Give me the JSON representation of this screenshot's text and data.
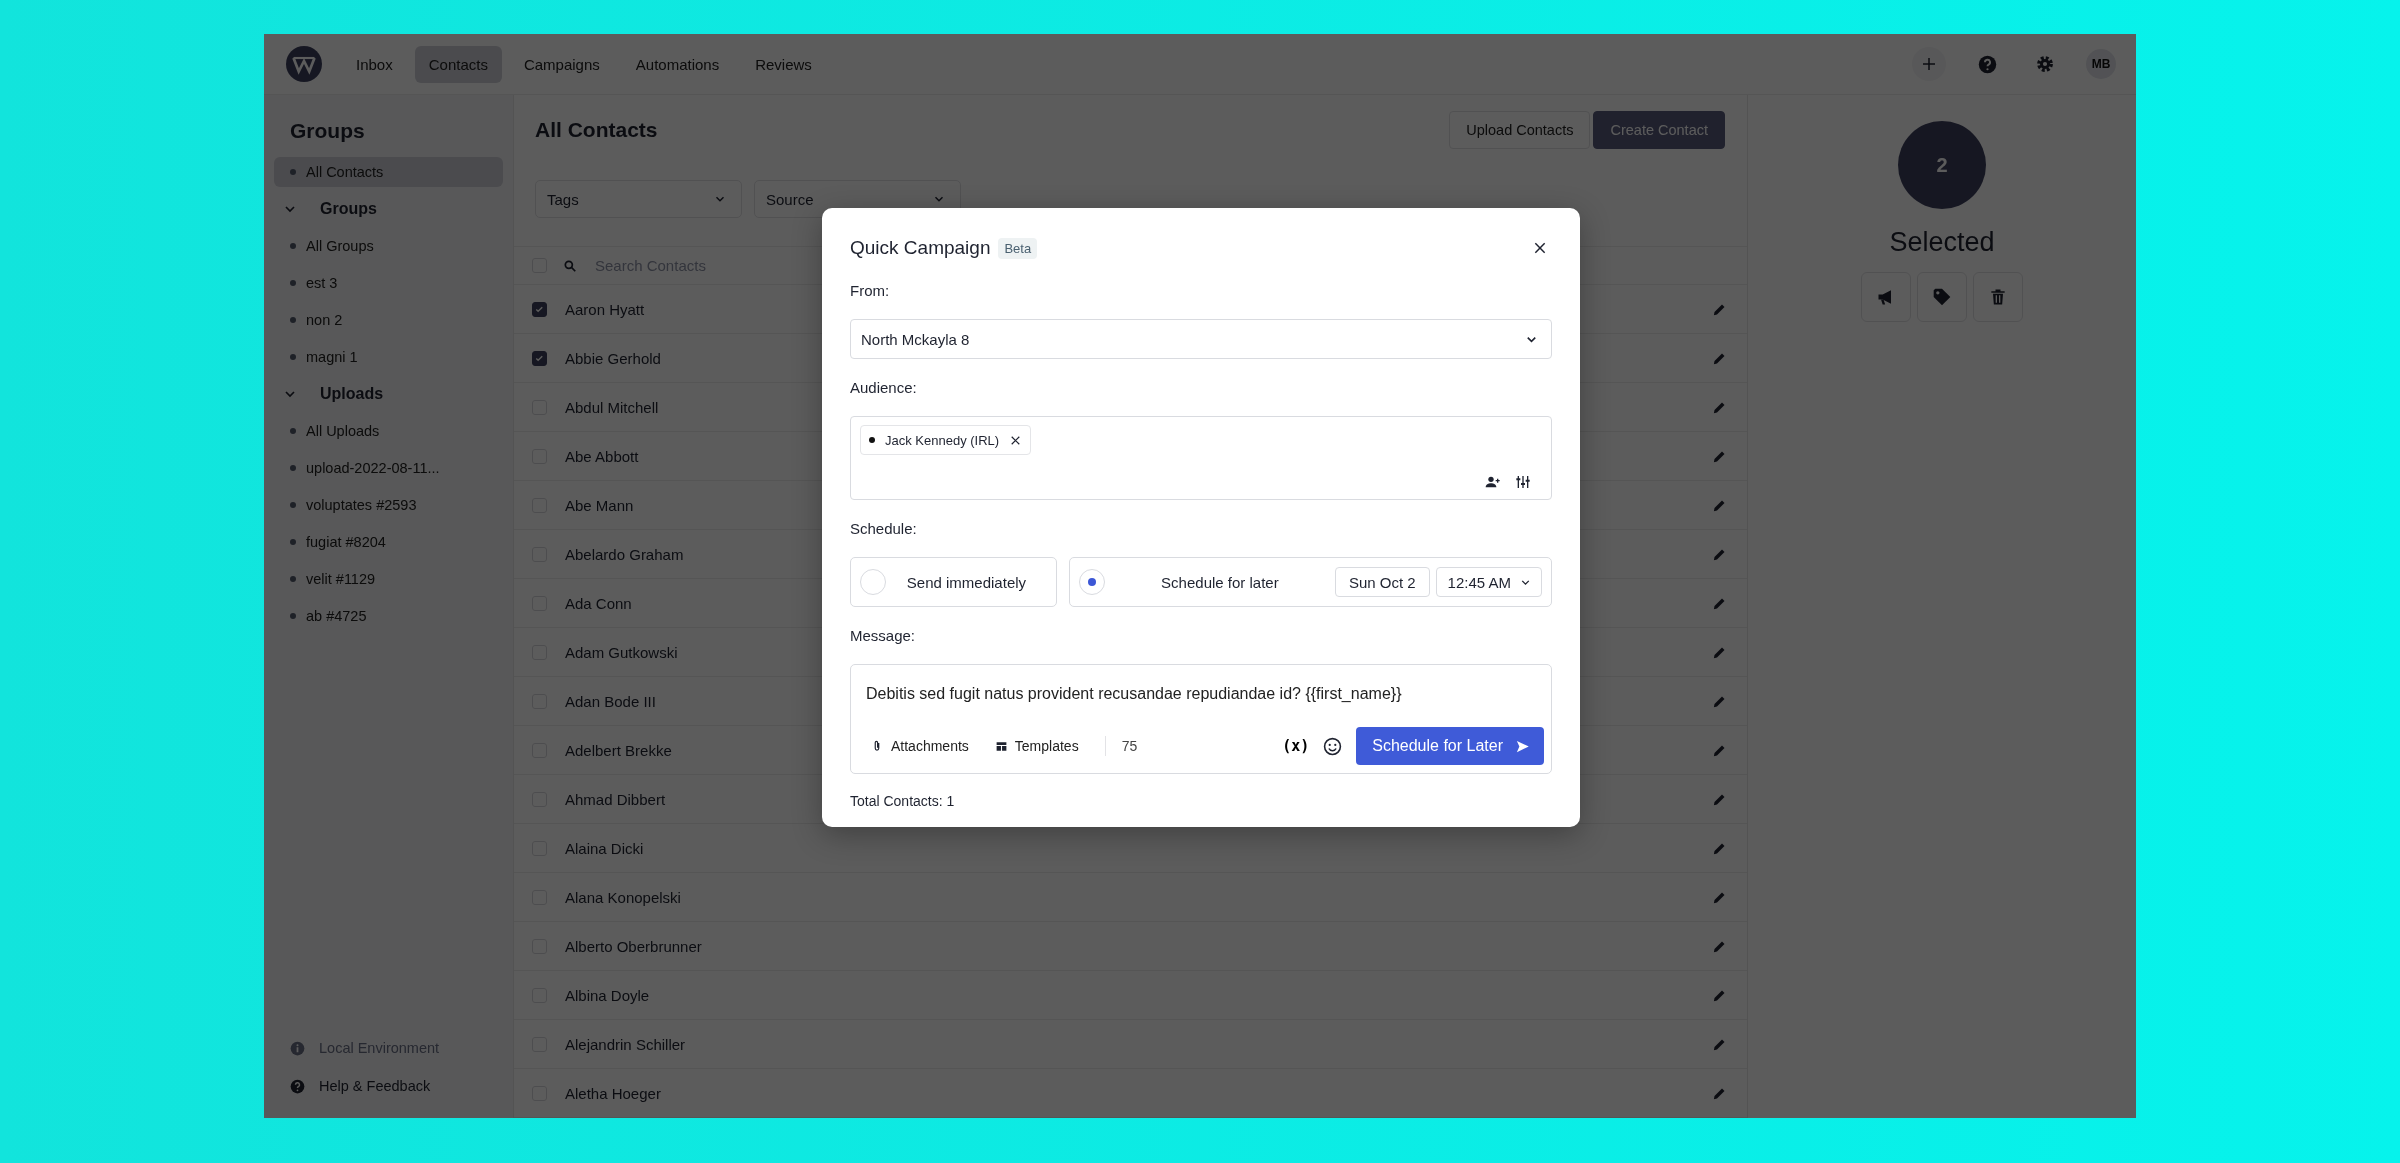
{
  "header": {
    "tabs": [
      {
        "label": "Inbox",
        "selected": false
      },
      {
        "label": "Contacts",
        "selected": true
      },
      {
        "label": "Campaigns",
        "selected": false
      },
      {
        "label": "Automations",
        "selected": false
      },
      {
        "label": "Reviews",
        "selected": false
      }
    ],
    "avatar": "MB"
  },
  "sidebar": {
    "title": "Groups",
    "items": [
      {
        "label": "All Contacts",
        "selected": true
      }
    ],
    "sections": [
      {
        "label": "Groups",
        "expanded": true,
        "children": [
          {
            "label": "All Groups",
            "selected": false
          },
          {
            "label": "est 3",
            "selected": false
          },
          {
            "label": "non 2",
            "selected": false
          },
          {
            "label": "magni 1",
            "selected": false
          }
        ]
      },
      {
        "label": "Uploads",
        "expanded": true,
        "children": [
          {
            "label": "All Uploads",
            "selected": false
          },
          {
            "label": "upload-2022-08-11...",
            "selected": false
          },
          {
            "label": "voluptates #2593",
            "selected": false
          },
          {
            "label": "fugiat #8204",
            "selected": false
          },
          {
            "label": "velit #1129",
            "selected": false
          },
          {
            "label": "ab #4725",
            "selected": false
          }
        ]
      }
    ],
    "footer": [
      {
        "kind": "info",
        "label": "Local Environment"
      },
      {
        "kind": "help",
        "label": "Help & Feedback"
      }
    ]
  },
  "main": {
    "title": "All Contacts",
    "buttons": [
      {
        "label": "Upload Contacts",
        "kind": "secondary"
      },
      {
        "label": "Create Contact",
        "kind": "primary"
      }
    ],
    "filters": [
      "Tags",
      "Source"
    ],
    "search": {
      "placeholder": "Search Contacts",
      "checked": false
    },
    "contacts": [
      {
        "name": "Aaron Hyatt",
        "checked": true
      },
      {
        "name": "Abbie Gerhold",
        "checked": true
      },
      {
        "name": "Abdul Mitchell",
        "checked": false
      },
      {
        "name": "Abe Abbott",
        "checked": false
      },
      {
        "name": "Abe Mann",
        "checked": false
      },
      {
        "name": "Abelardo Graham",
        "checked": false
      },
      {
        "name": "Ada Conn",
        "checked": false
      },
      {
        "name": "Adam Gutkowski",
        "checked": false
      },
      {
        "name": "Adan Bode III",
        "checked": false
      },
      {
        "name": "Adelbert Brekke",
        "checked": false
      },
      {
        "name": "Ahmad Dibbert",
        "checked": false
      },
      {
        "name": "Alaina Dicki",
        "checked": false
      },
      {
        "name": "Alana Konopelski",
        "checked": false
      },
      {
        "name": "Alberto Oberbrunner",
        "checked": false
      },
      {
        "name": "Albina Doyle",
        "checked": false
      },
      {
        "name": "Alejandrin Schiller",
        "checked": false
      },
      {
        "name": "Aletha Hoeger",
        "checked": false
      }
    ]
  },
  "selection_panel": {
    "count": "2",
    "label": "Selected"
  },
  "modal": {
    "title": "Quick Campaign",
    "badge": "Beta",
    "from": {
      "label": "From:",
      "value": "North Mckayla 8"
    },
    "audience": {
      "label": "Audience:",
      "chips": [
        "Jack Kennedy (IRL)"
      ]
    },
    "schedule": {
      "label": "Schedule:",
      "options": [
        {
          "label": "Send immediately",
          "selected": false
        },
        {
          "label": "Schedule for later",
          "selected": true
        }
      ],
      "date": "Sun Oct 2",
      "time": "12:45 AM"
    },
    "message": {
      "label": "Message:",
      "value": "Debitis sed fugit natus provident recusandae repudiandae id? {{first_name}}",
      "attachments": "Attachments",
      "templates": "Templates",
      "count": "75",
      "variable": "(x)",
      "send": "Schedule for Later"
    },
    "total": "Total Contacts: 1"
  }
}
